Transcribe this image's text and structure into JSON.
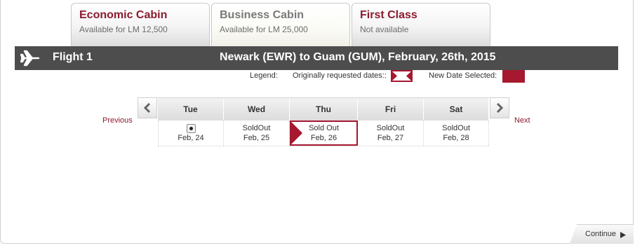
{
  "tabs": [
    {
      "title": "Economic Cabin",
      "subtitle": "Available for LM 12,500"
    },
    {
      "title": "Business Cabin",
      "subtitle": "Available for LM 25,000"
    },
    {
      "title": "First Class",
      "subtitle": "Not available"
    }
  ],
  "flight": {
    "label": "Flight 1",
    "route": "Newark (EWR) to Guam (GUM), February, 26th, 2015"
  },
  "legend": {
    "label": "Legend:",
    "original": "Originally requested dates::",
    "new": "New Date Selected:",
    "color_selected": "#a5182f"
  },
  "nav": {
    "previous": "Previous",
    "next": "Next"
  },
  "days": [
    {
      "day": "Tue",
      "status": "",
      "date": "Feb, 24"
    },
    {
      "day": "Wed",
      "status": "SoldOut",
      "date": "Feb, 25"
    },
    {
      "day": "Thu",
      "status": "Sold Out",
      "date": "Feb, 26"
    },
    {
      "day": "Fri",
      "status": "SoldOut",
      "date": "Feb, 27"
    },
    {
      "day": "Sat",
      "status": "SoldOut",
      "date": "Feb, 28"
    }
  ],
  "continue": {
    "label": "Continue"
  },
  "icons": {
    "flight": "airplane-icon",
    "prev": "chevron-left-icon",
    "next": "chevron-right-icon",
    "continue": "caret-right-icon"
  }
}
